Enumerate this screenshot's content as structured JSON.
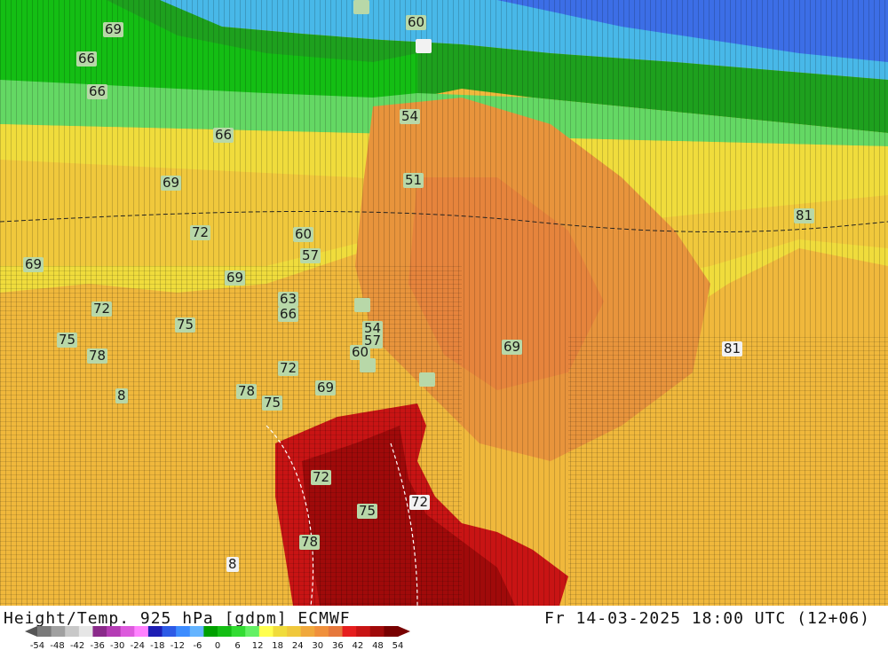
{
  "title": "Height/Temp. 925 hPa [gdpm] ECMWF",
  "valid_time": "Fr 14-03-2025 18:00 UTC (12+06)",
  "colorbar": {
    "ticks": [
      "-54",
      "-48",
      "-42",
      "-36",
      "-30",
      "-24",
      "-18",
      "-12",
      "-6",
      "0",
      "6",
      "12",
      "18",
      "24",
      "30",
      "36",
      "42",
      "48",
      "54"
    ],
    "colors": [
      "#7a7a7a",
      "#a0a0a0",
      "#c8c8c8",
      "#e6e6e6",
      "#8a2a8a",
      "#b43cb4",
      "#dc5adc",
      "#ff82ff",
      "#1e1eb4",
      "#2d5ae6",
      "#3c8cff",
      "#64b4ff",
      "#00a000",
      "#14be14",
      "#32dc32",
      "#64f064",
      "#ffff50",
      "#f0dc3c",
      "#f0c83c",
      "#f0a83c",
      "#f0903c",
      "#e6783c",
      "#e61e1e",
      "#c81414",
      "#a00a0a",
      "#780000"
    ]
  },
  "contour_labels": [
    {
      "text": "69"
    },
    {
      "text": "60"
    },
    {
      "text": "66"
    },
    {
      "text": "66"
    },
    {
      "text": "54"
    },
    {
      "text": "66"
    },
    {
      "text": "69"
    },
    {
      "text": "51"
    },
    {
      "text": "81"
    },
    {
      "text": "72"
    },
    {
      "text": "60"
    },
    {
      "text": "57"
    },
    {
      "text": "69"
    },
    {
      "text": "69"
    },
    {
      "text": "63"
    },
    {
      "text": "66"
    },
    {
      "text": "72"
    },
    {
      "text": "75"
    },
    {
      "text": "54"
    },
    {
      "text": "57"
    },
    {
      "text": "75"
    },
    {
      "text": "60"
    },
    {
      "text": "69"
    },
    {
      "text": "81"
    },
    {
      "text": "78"
    },
    {
      "text": "72"
    },
    {
      "text": "69"
    },
    {
      "text": "8"
    },
    {
      "text": "78"
    },
    {
      "text": "75"
    },
    {
      "text": "72"
    },
    {
      "text": "72"
    },
    {
      "text": "75"
    },
    {
      "text": "78"
    },
    {
      "text": "8"
    }
  ]
}
